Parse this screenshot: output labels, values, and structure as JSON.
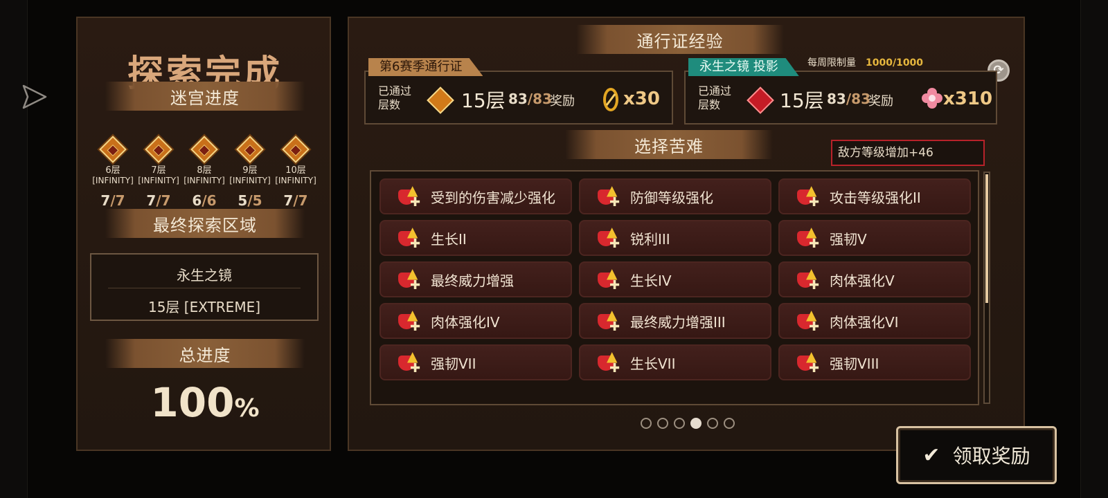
{
  "summary": {
    "title": "探索完成",
    "labyrinth_progress_label": "迷宫进度",
    "floors": [
      {
        "name": "6层",
        "mode": "[INFINITY]",
        "cleared": "7",
        "total": "/7"
      },
      {
        "name": "7层",
        "mode": "[INFINITY]",
        "cleared": "7",
        "total": "/7"
      },
      {
        "name": "8层",
        "mode": "[INFINITY]",
        "cleared": "6",
        "total": "/6"
      },
      {
        "name": "9层",
        "mode": "[INFINITY]",
        "cleared": "5",
        "total": "/5"
      },
      {
        "name": "10层",
        "mode": "[INFINITY]",
        "cleared": "7",
        "total": "/7"
      }
    ],
    "final_area_label": "最终探索区域",
    "final_area_name": "永生之镜",
    "final_area_floor": "15层 [EXTREME]",
    "total_progress_label": "总进度",
    "total_progress_value": "100",
    "total_progress_unit": "%"
  },
  "pass_exp": {
    "title": "通行证经验",
    "weekly_limit_label": "每周限制量",
    "weekly_limit_value": "1000/1000",
    "season_pass": {
      "tag": "第6赛季通行证",
      "passed_label": "已通过层数",
      "floors": "15层",
      "count_got": "83",
      "count_total": "/83",
      "reward_label": "奖励",
      "reward_qty": "x30",
      "reward_icon": "gold-ring-icon"
    },
    "mirror_pass": {
      "tag": "永生之镜 投影",
      "passed_label": "已通过层数",
      "floors": "15层",
      "count_got": "83",
      "count_total": "/83",
      "reward_label": "奖励",
      "reward_qty": "x310",
      "reward_icon": "pink-flower-icon"
    }
  },
  "hardship": {
    "title": "选择苦难",
    "enemy_level": "敌方等级增加+46",
    "items": [
      {
        "label": "受到的伤害减少强化",
        "icon": "damage-reduction-icon"
      },
      {
        "label": "防御等级强化",
        "icon": "shield-plus-icon"
      },
      {
        "label": "攻击等级强化II",
        "icon": "attack-plus-icon"
      },
      {
        "label": "生长II",
        "icon": "heart-up-icon"
      },
      {
        "label": "锐利III",
        "icon": "sharp-up-icon"
      },
      {
        "label": "强韧V",
        "icon": "tough-up-icon"
      },
      {
        "label": "最终威力增强",
        "icon": "power-up-icon"
      },
      {
        "label": "生长IV",
        "icon": "heart-up-icon"
      },
      {
        "label": "肉体强化V",
        "icon": "body-up-icon"
      },
      {
        "label": "肉体强化IV",
        "icon": "body-up-icon"
      },
      {
        "label": "最终威力增强III",
        "icon": "power-up-icon"
      },
      {
        "label": "肉体强化VI",
        "icon": "body-up-icon"
      },
      {
        "label": "强韧VII",
        "icon": "tough-up-icon"
      },
      {
        "label": "生长VII",
        "icon": "heart-up-icon"
      },
      {
        "label": "强韧VIII",
        "icon": "tough-up-icon"
      }
    ]
  },
  "pager": {
    "count": 6,
    "active": 3
  },
  "claim_button": {
    "label": "领取奖励"
  },
  "colors": {
    "accent_gold": "#e7b73e",
    "enemy_border": "#b8222a",
    "teal_tag": "#1f8c7d"
  }
}
